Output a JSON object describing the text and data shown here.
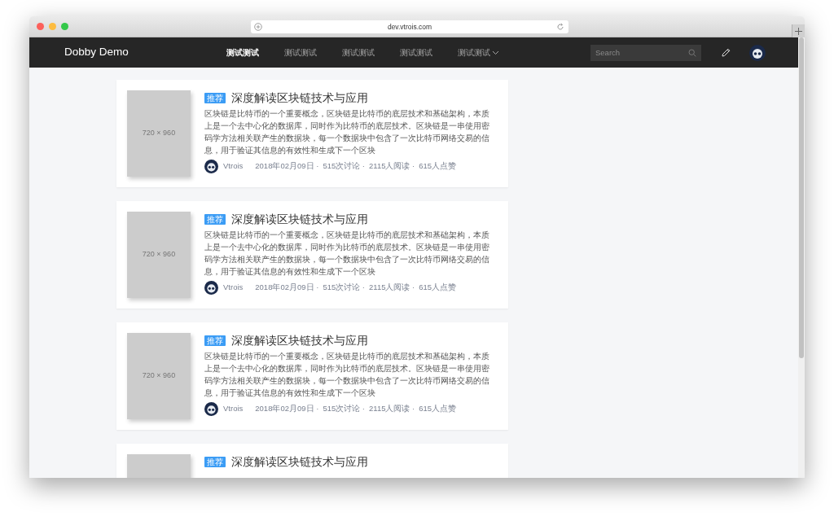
{
  "browser": {
    "url": "dev.vtrois.com"
  },
  "navbar": {
    "brand": "Dobby Demo",
    "items": [
      {
        "label": "测试测试",
        "selected": true,
        "dropdown": false
      },
      {
        "label": "测试测试",
        "selected": false,
        "dropdown": false
      },
      {
        "label": "测试测试",
        "selected": false,
        "dropdown": false
      },
      {
        "label": "测试测试",
        "selected": false,
        "dropdown": false
      },
      {
        "label": "测试测试",
        "selected": false,
        "dropdown": true
      }
    ],
    "search": {
      "placeholder": "Search"
    }
  },
  "articles": [
    {
      "thumbnail": "720 × 960",
      "badge": "推荐",
      "title": "深度解读区块链技术与应用",
      "excerpt": "区块链是比特币的一个重要概念，区块链是比特币的底层技术和基础架构，本质上是一个去中心化的数据库，同时作为比特币的底层技术。区块链是一串使用密码学方法相关联产生的数据块，每一个数据块中包含了一次比特币网络交易的信息，用于验证其信息的有效性和生成下一个区块",
      "author": "Vtrois",
      "date": "2018年02月09日 ·",
      "comments": "515次讨论 ·",
      "reads": "2115人阅读 ·",
      "likes": "615人点赞"
    },
    {
      "thumbnail": "720 × 960",
      "badge": "推荐",
      "title": "深度解读区块链技术与应用",
      "excerpt": "区块链是比特币的一个重要概念，区块链是比特币的底层技术和基础架构，本质上是一个去中心化的数据库，同时作为比特币的底层技术。区块链是一串使用密码学方法相关联产生的数据块，每一个数据块中包含了一次比特币网络交易的信息，用于验证其信息的有效性和生成下一个区块",
      "author": "Vtrois",
      "date": "2018年02月09日 ·",
      "comments": "515次讨论 ·",
      "reads": "2115人阅读 ·",
      "likes": "615人点赞"
    },
    {
      "thumbnail": "720 × 960",
      "badge": "推荐",
      "title": "深度解读区块链技术与应用",
      "excerpt": "区块链是比特币的一个重要概念，区块链是比特币的底层技术和基础架构，本质上是一个去中心化的数据库，同时作为比特币的底层技术。区块链是一串使用密码学方法相关联产生的数据块，每一个数据块中包含了一次比特币网络交易的信息，用于验证其信息的有效性和生成下一个区块",
      "author": "Vtrois",
      "date": "2018年02月09日 ·",
      "comments": "515次讨论 ·",
      "reads": "2115人阅读 ·",
      "likes": "615人点赞"
    },
    {
      "badge": "推荐",
      "title": "深度解读区块链技术与应用"
    }
  ]
}
